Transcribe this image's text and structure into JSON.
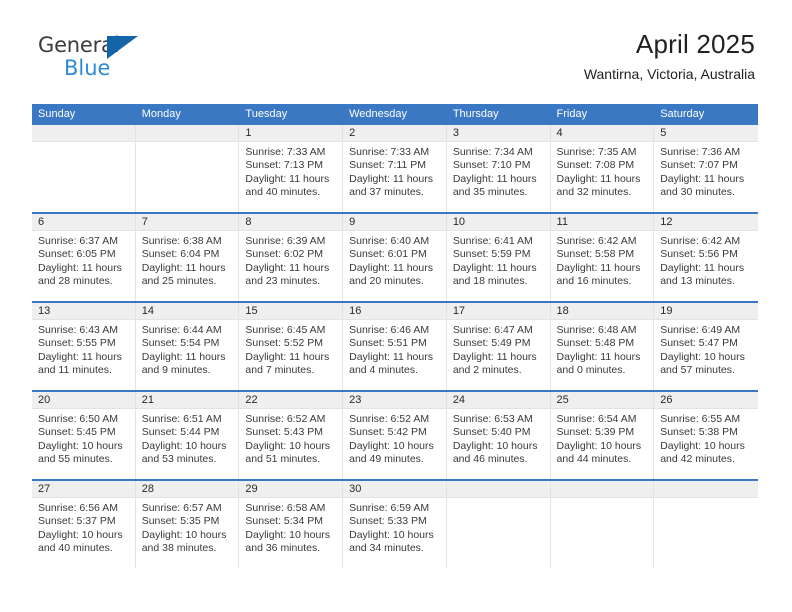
{
  "brand": {
    "name_part1": "General",
    "name_part2": "Blue",
    "flag_color": "#1464aa",
    "blue_color": "#2e8ad6"
  },
  "header": {
    "title": "April 2025",
    "location": "Wantirna, Victoria, Australia"
  },
  "theme": {
    "header_blue": "#3b78c3",
    "daynum_band": "#efefef",
    "cell_border": "#e3e3e3",
    "text": "#3a3a3a"
  },
  "weekdays": [
    "Sunday",
    "Monday",
    "Tuesday",
    "Wednesday",
    "Thursday",
    "Friday",
    "Saturday"
  ],
  "weeks": [
    [
      {
        "day": "",
        "sunrise": "",
        "sunset": "",
        "daylight": "",
        "empty": true
      },
      {
        "day": "",
        "sunrise": "",
        "sunset": "",
        "daylight": "",
        "empty": true
      },
      {
        "day": "1",
        "sunrise": "Sunrise: 7:33 AM",
        "sunset": "Sunset: 7:13 PM",
        "daylight": "Daylight: 11 hours and 40 minutes."
      },
      {
        "day": "2",
        "sunrise": "Sunrise: 7:33 AM",
        "sunset": "Sunset: 7:11 PM",
        "daylight": "Daylight: 11 hours and 37 minutes."
      },
      {
        "day": "3",
        "sunrise": "Sunrise: 7:34 AM",
        "sunset": "Sunset: 7:10 PM",
        "daylight": "Daylight: 11 hours and 35 minutes."
      },
      {
        "day": "4",
        "sunrise": "Sunrise: 7:35 AM",
        "sunset": "Sunset: 7:08 PM",
        "daylight": "Daylight: 11 hours and 32 minutes."
      },
      {
        "day": "5",
        "sunrise": "Sunrise: 7:36 AM",
        "sunset": "Sunset: 7:07 PM",
        "daylight": "Daylight: 11 hours and 30 minutes."
      }
    ],
    [
      {
        "day": "6",
        "sunrise": "Sunrise: 6:37 AM",
        "sunset": "Sunset: 6:05 PM",
        "daylight": "Daylight: 11 hours and 28 minutes."
      },
      {
        "day": "7",
        "sunrise": "Sunrise: 6:38 AM",
        "sunset": "Sunset: 6:04 PM",
        "daylight": "Daylight: 11 hours and 25 minutes."
      },
      {
        "day": "8",
        "sunrise": "Sunrise: 6:39 AM",
        "sunset": "Sunset: 6:02 PM",
        "daylight": "Daylight: 11 hours and 23 minutes."
      },
      {
        "day": "9",
        "sunrise": "Sunrise: 6:40 AM",
        "sunset": "Sunset: 6:01 PM",
        "daylight": "Daylight: 11 hours and 20 minutes."
      },
      {
        "day": "10",
        "sunrise": "Sunrise: 6:41 AM",
        "sunset": "Sunset: 5:59 PM",
        "daylight": "Daylight: 11 hours and 18 minutes."
      },
      {
        "day": "11",
        "sunrise": "Sunrise: 6:42 AM",
        "sunset": "Sunset: 5:58 PM",
        "daylight": "Daylight: 11 hours and 16 minutes."
      },
      {
        "day": "12",
        "sunrise": "Sunrise: 6:42 AM",
        "sunset": "Sunset: 5:56 PM",
        "daylight": "Daylight: 11 hours and 13 minutes."
      }
    ],
    [
      {
        "day": "13",
        "sunrise": "Sunrise: 6:43 AM",
        "sunset": "Sunset: 5:55 PM",
        "daylight": "Daylight: 11 hours and 11 minutes."
      },
      {
        "day": "14",
        "sunrise": "Sunrise: 6:44 AM",
        "sunset": "Sunset: 5:54 PM",
        "daylight": "Daylight: 11 hours and 9 minutes."
      },
      {
        "day": "15",
        "sunrise": "Sunrise: 6:45 AM",
        "sunset": "Sunset: 5:52 PM",
        "daylight": "Daylight: 11 hours and 7 minutes."
      },
      {
        "day": "16",
        "sunrise": "Sunrise: 6:46 AM",
        "sunset": "Sunset: 5:51 PM",
        "daylight": "Daylight: 11 hours and 4 minutes."
      },
      {
        "day": "17",
        "sunrise": "Sunrise: 6:47 AM",
        "sunset": "Sunset: 5:49 PM",
        "daylight": "Daylight: 11 hours and 2 minutes."
      },
      {
        "day": "18",
        "sunrise": "Sunrise: 6:48 AM",
        "sunset": "Sunset: 5:48 PM",
        "daylight": "Daylight: 11 hours and 0 minutes."
      },
      {
        "day": "19",
        "sunrise": "Sunrise: 6:49 AM",
        "sunset": "Sunset: 5:47 PM",
        "daylight": "Daylight: 10 hours and 57 minutes."
      }
    ],
    [
      {
        "day": "20",
        "sunrise": "Sunrise: 6:50 AM",
        "sunset": "Sunset: 5:45 PM",
        "daylight": "Daylight: 10 hours and 55 minutes."
      },
      {
        "day": "21",
        "sunrise": "Sunrise: 6:51 AM",
        "sunset": "Sunset: 5:44 PM",
        "daylight": "Daylight: 10 hours and 53 minutes."
      },
      {
        "day": "22",
        "sunrise": "Sunrise: 6:52 AM",
        "sunset": "Sunset: 5:43 PM",
        "daylight": "Daylight: 10 hours and 51 minutes."
      },
      {
        "day": "23",
        "sunrise": "Sunrise: 6:52 AM",
        "sunset": "Sunset: 5:42 PM",
        "daylight": "Daylight: 10 hours and 49 minutes."
      },
      {
        "day": "24",
        "sunrise": "Sunrise: 6:53 AM",
        "sunset": "Sunset: 5:40 PM",
        "daylight": "Daylight: 10 hours and 46 minutes."
      },
      {
        "day": "25",
        "sunrise": "Sunrise: 6:54 AM",
        "sunset": "Sunset: 5:39 PM",
        "daylight": "Daylight: 10 hours and 44 minutes."
      },
      {
        "day": "26",
        "sunrise": "Sunrise: 6:55 AM",
        "sunset": "Sunset: 5:38 PM",
        "daylight": "Daylight: 10 hours and 42 minutes."
      }
    ],
    [
      {
        "day": "27",
        "sunrise": "Sunrise: 6:56 AM",
        "sunset": "Sunset: 5:37 PM",
        "daylight": "Daylight: 10 hours and 40 minutes."
      },
      {
        "day": "28",
        "sunrise": "Sunrise: 6:57 AM",
        "sunset": "Sunset: 5:35 PM",
        "daylight": "Daylight: 10 hours and 38 minutes."
      },
      {
        "day": "29",
        "sunrise": "Sunrise: 6:58 AM",
        "sunset": "Sunset: 5:34 PM",
        "daylight": "Daylight: 10 hours and 36 minutes."
      },
      {
        "day": "30",
        "sunrise": "Sunrise: 6:59 AM",
        "sunset": "Sunset: 5:33 PM",
        "daylight": "Daylight: 10 hours and 34 minutes."
      },
      {
        "day": "",
        "sunrise": "",
        "sunset": "",
        "daylight": "",
        "empty": true
      },
      {
        "day": "",
        "sunrise": "",
        "sunset": "",
        "daylight": "",
        "empty": true
      },
      {
        "day": "",
        "sunrise": "",
        "sunset": "",
        "daylight": "",
        "empty": true
      }
    ]
  ]
}
